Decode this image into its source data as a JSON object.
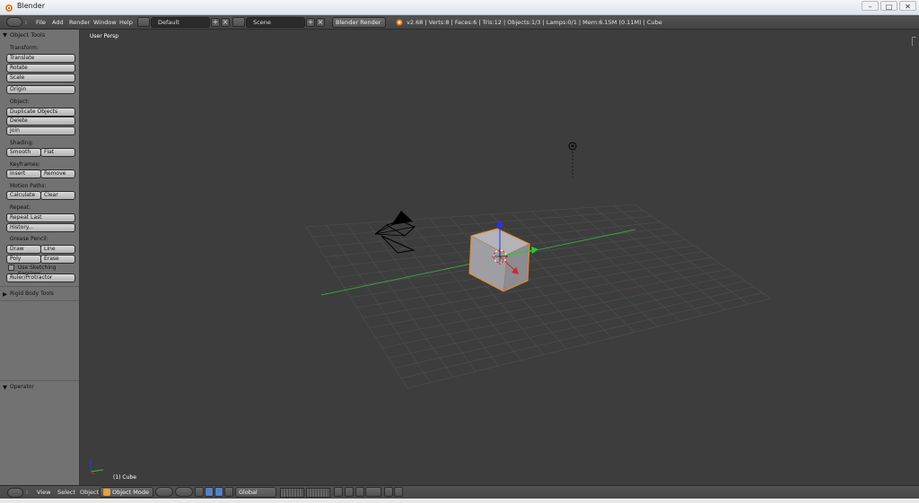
{
  "window": {
    "title": "Blender",
    "controls": [
      "–",
      "□",
      "✕"
    ]
  },
  "info_header": {
    "menus": [
      "File",
      "Add",
      "Render",
      "Window",
      "Help"
    ],
    "screen_layout": "Default",
    "scene": "Scene",
    "render_engine": "Blender Render",
    "stats": "v2.68 | Verts:8 | Faces:6 | Tris:12 | Objects:1/3 | Lamps:0/1 | Mem:6.15M (0.11M) | Cube"
  },
  "tool_shelf": {
    "panel_title": "Object Tools",
    "transform_label": "Transform:",
    "translate": "Translate",
    "rotate": "Rotate",
    "scale": "Scale",
    "origin": "Origin",
    "object_label": "Object:",
    "duplicate": "Duplicate Objects",
    "delete": "Delete",
    "join": "Join",
    "shading_label": "Shading:",
    "smooth": "Smooth",
    "flat": "Flat",
    "keyframes_label": "Keyframes:",
    "insert": "Insert",
    "remove": "Remove",
    "motion_paths_label": "Motion Paths:",
    "calculate": "Calculate",
    "clear": "Clear",
    "repeat_label": "Repeat:",
    "repeat_last": "Repeat Last",
    "history": "History...",
    "grease_pencil_label": "Grease Pencil:",
    "draw": "Draw",
    "line": "Line",
    "poly": "Poly",
    "erase": "Erase",
    "use_sketching": "Use Sketching Sessions",
    "use_sketching_checked": false,
    "ruler": "Ruler/Protractor",
    "rigid_body_tools": "Rigid Body Tools",
    "operator": "Operator"
  },
  "viewport": {
    "view_label": "User Persp",
    "active_object": "(1) Cube",
    "colors": {
      "background": "#3d3d3d",
      "grid": "#4b4b4b",
      "x_axis": "#a03535",
      "y_axis": "#3aa03a",
      "selection_outline": "#f08c1e"
    }
  },
  "footer": {
    "menus": [
      "View",
      "Select",
      "Object"
    ],
    "mode": "Object Mode",
    "transform_orientation": "Global"
  }
}
